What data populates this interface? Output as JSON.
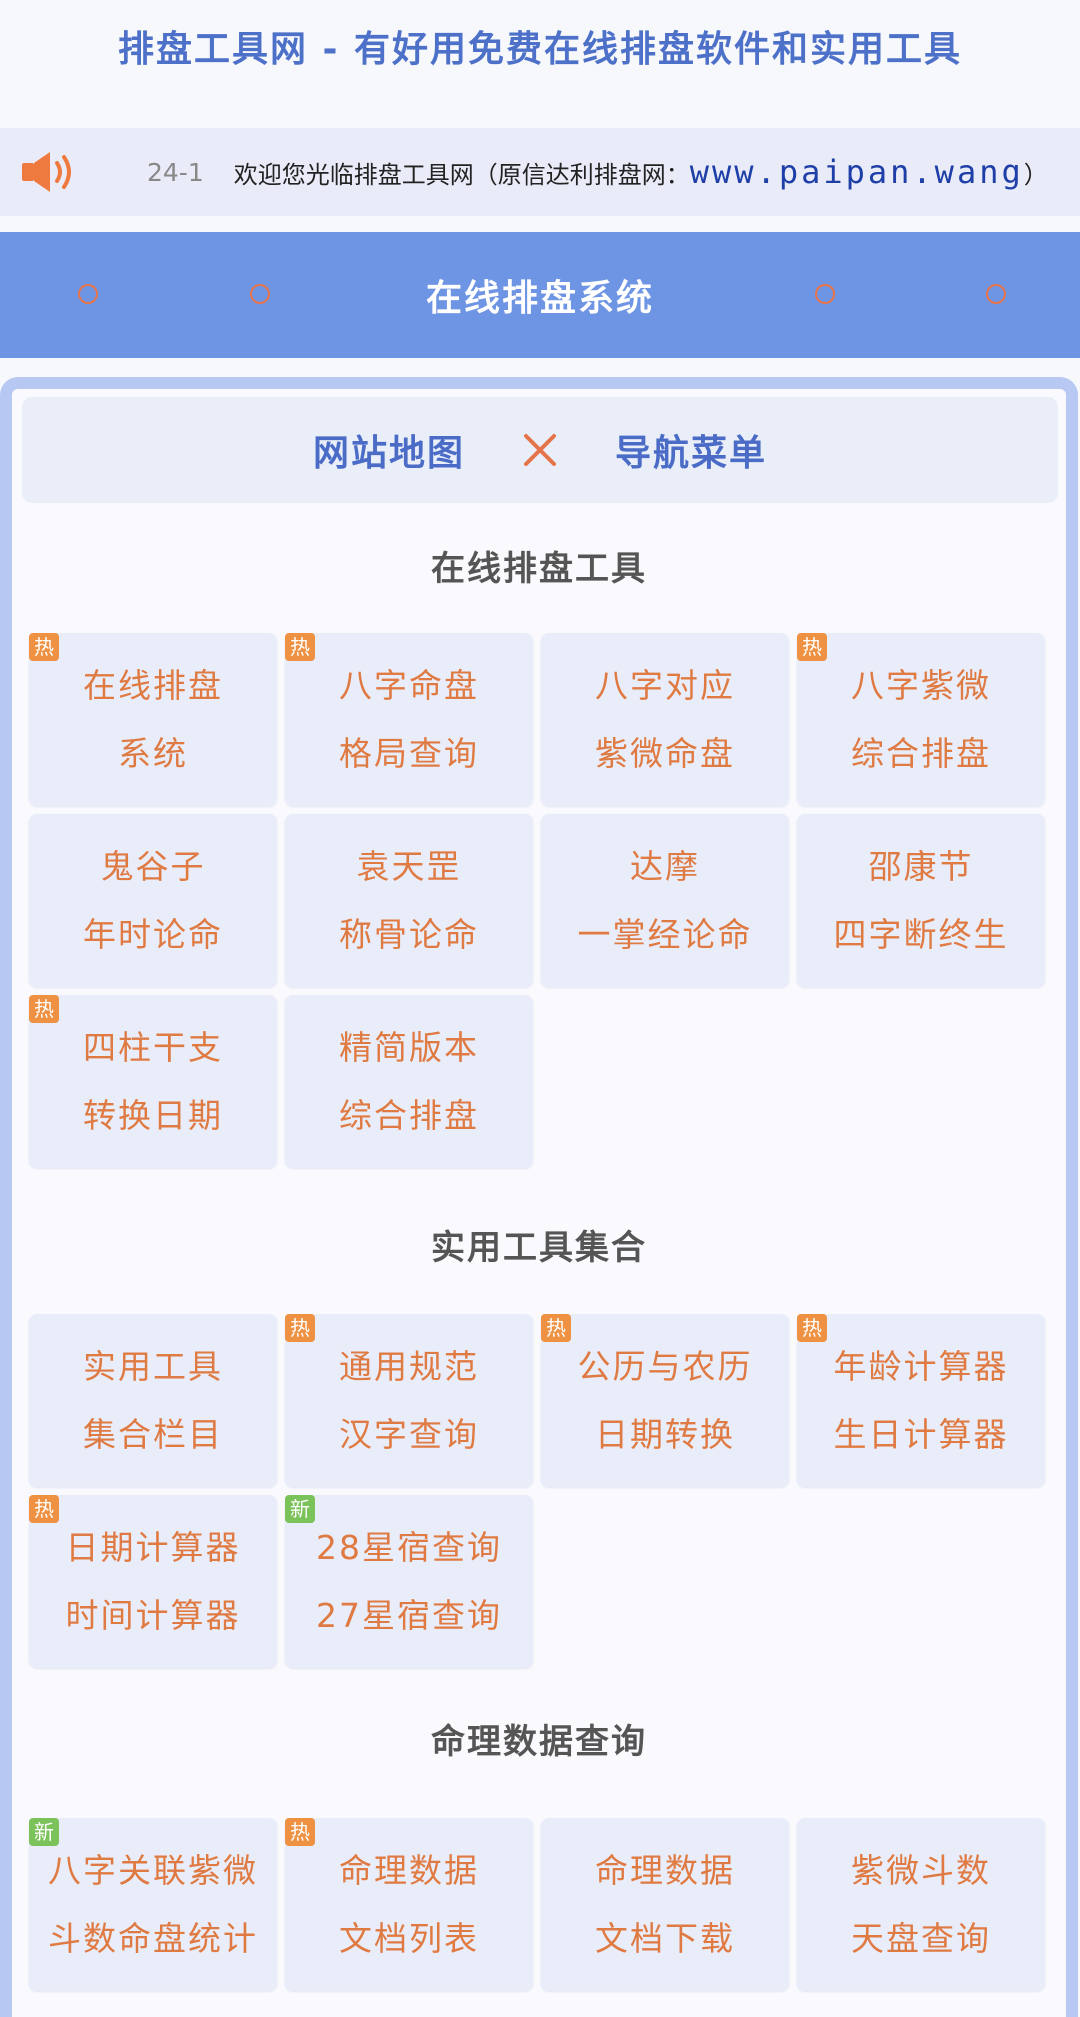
{
  "site_title": "排盘工具网 - 有好用免费在线排盘软件和实用工具",
  "notice": {
    "date": "24-1",
    "message": "欢迎您光临排盘工具网（原信达利排盘网：",
    "url": "www.paipan.wang",
    "tail": "）"
  },
  "banner": {
    "title": "在线排盘系统"
  },
  "nav": {
    "left": "网站地图",
    "right": "导航菜单"
  },
  "colors": {
    "accent": "#6e94e4",
    "tile_text": "#e07a43",
    "hot_badge": "#ee9142",
    "new_badge": "#7cc25a"
  },
  "sections": [
    {
      "title": "在线排盘工具",
      "tiles": [
        {
          "line1": "在线排盘",
          "line2": "系统",
          "badge": "热"
        },
        {
          "line1": "八字命盘",
          "line2": "格局查询",
          "badge": "热"
        },
        {
          "line1": "八字对应",
          "line2": "紫微命盘",
          "badge": ""
        },
        {
          "line1": "八字紫微",
          "line2": "综合排盘",
          "badge": "热"
        },
        {
          "line1": "鬼谷子",
          "line2": "年时论命",
          "badge": ""
        },
        {
          "line1": "袁天罡",
          "line2": "称骨论命",
          "badge": ""
        },
        {
          "line1": "达摩",
          "line2": "一掌经论命",
          "badge": ""
        },
        {
          "line1": "邵康节",
          "line2": "四字断终生",
          "badge": ""
        },
        {
          "line1": "四柱干支",
          "line2": "转换日期",
          "badge": "热"
        },
        {
          "line1": "精简版本",
          "line2": "综合排盘",
          "badge": ""
        }
      ]
    },
    {
      "title": "实用工具集合",
      "tiles": [
        {
          "line1": "实用工具",
          "line2": "集合栏目",
          "badge": ""
        },
        {
          "line1": "通用规范",
          "line2": "汉字查询",
          "badge": "热"
        },
        {
          "line1": "公历与农历",
          "line2": "日期转换",
          "badge": "热"
        },
        {
          "line1": "年龄计算器",
          "line2": "生日计算器",
          "badge": "热"
        },
        {
          "line1": "日期计算器",
          "line2": "时间计算器",
          "badge": "热"
        },
        {
          "line1": "28星宿查询",
          "line2": "27星宿查询",
          "badge": "新"
        }
      ]
    },
    {
      "title": "命理数据查询",
      "tiles": [
        {
          "line1": "八字关联紫微",
          "line2": "斗数命盘统计",
          "badge": "新"
        },
        {
          "line1": "命理数据",
          "line2": "文档列表",
          "badge": "热"
        },
        {
          "line1": "命理数据",
          "line2": "文档下载",
          "badge": ""
        },
        {
          "line1": "紫微斗数",
          "line2": "天盘查询",
          "badge": ""
        }
      ]
    }
  ]
}
